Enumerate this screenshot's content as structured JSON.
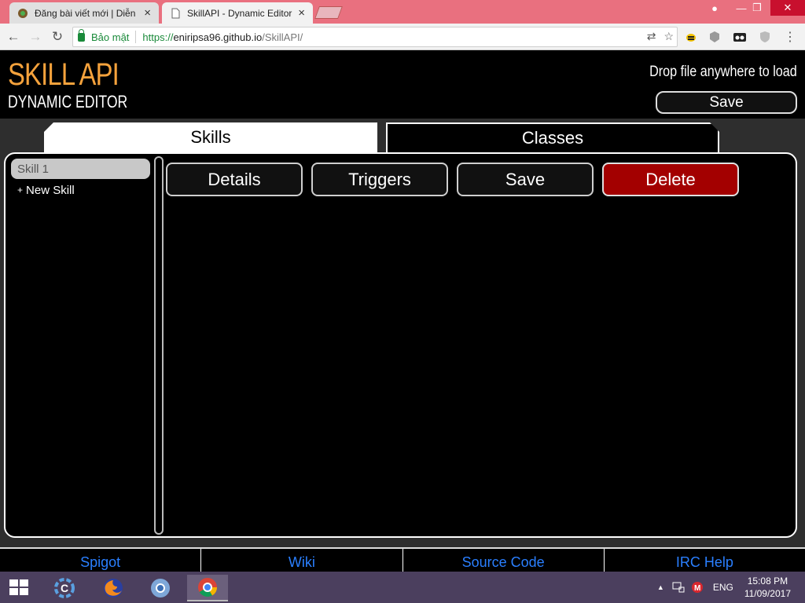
{
  "browser": {
    "tabs": [
      {
        "title": "Đăng bài viết mới | Diễn",
        "active": false
      },
      {
        "title": "SkillAPI - Dynamic Editor",
        "active": true
      }
    ],
    "window_controls": {
      "user": "●",
      "minimize": "—",
      "restore": "❐",
      "close": "✕"
    },
    "nav": {
      "back": "←",
      "forward": "→",
      "reload": "↻"
    },
    "address": {
      "security_label": "Bảo mật",
      "scheme": "https://",
      "host": "eniripsa96.github.io",
      "path": "/SkillAPI/"
    },
    "omnibox_icons": {
      "translate": "⇄",
      "bookmark": "☆"
    }
  },
  "app": {
    "logo_title": "SKILL API",
    "logo_subtitle": "DYNAMIC EDITOR",
    "drop_text": "Drop file anywhere to load",
    "top_save_label": "Save",
    "tabs": {
      "skills": "Skills",
      "classes": "Classes"
    },
    "active_tab": "skills",
    "skill_list": [
      "Skill 1"
    ],
    "new_skill_label": "New Skill",
    "new_skill_plus": "+",
    "buttons": {
      "details": "Details",
      "triggers": "Triggers",
      "save": "Save",
      "delete": "Delete"
    },
    "footer_links": [
      "Spigot",
      "Wiki",
      "Source Code",
      "IRC Help"
    ],
    "colors": {
      "logo": "#f5a23c",
      "delete": "#a30000",
      "link": "#2a7fff"
    }
  },
  "taskbar": {
    "language": "ENG",
    "time": "15:08 PM",
    "date": "11/09/2017",
    "tray_caret": "▲"
  }
}
